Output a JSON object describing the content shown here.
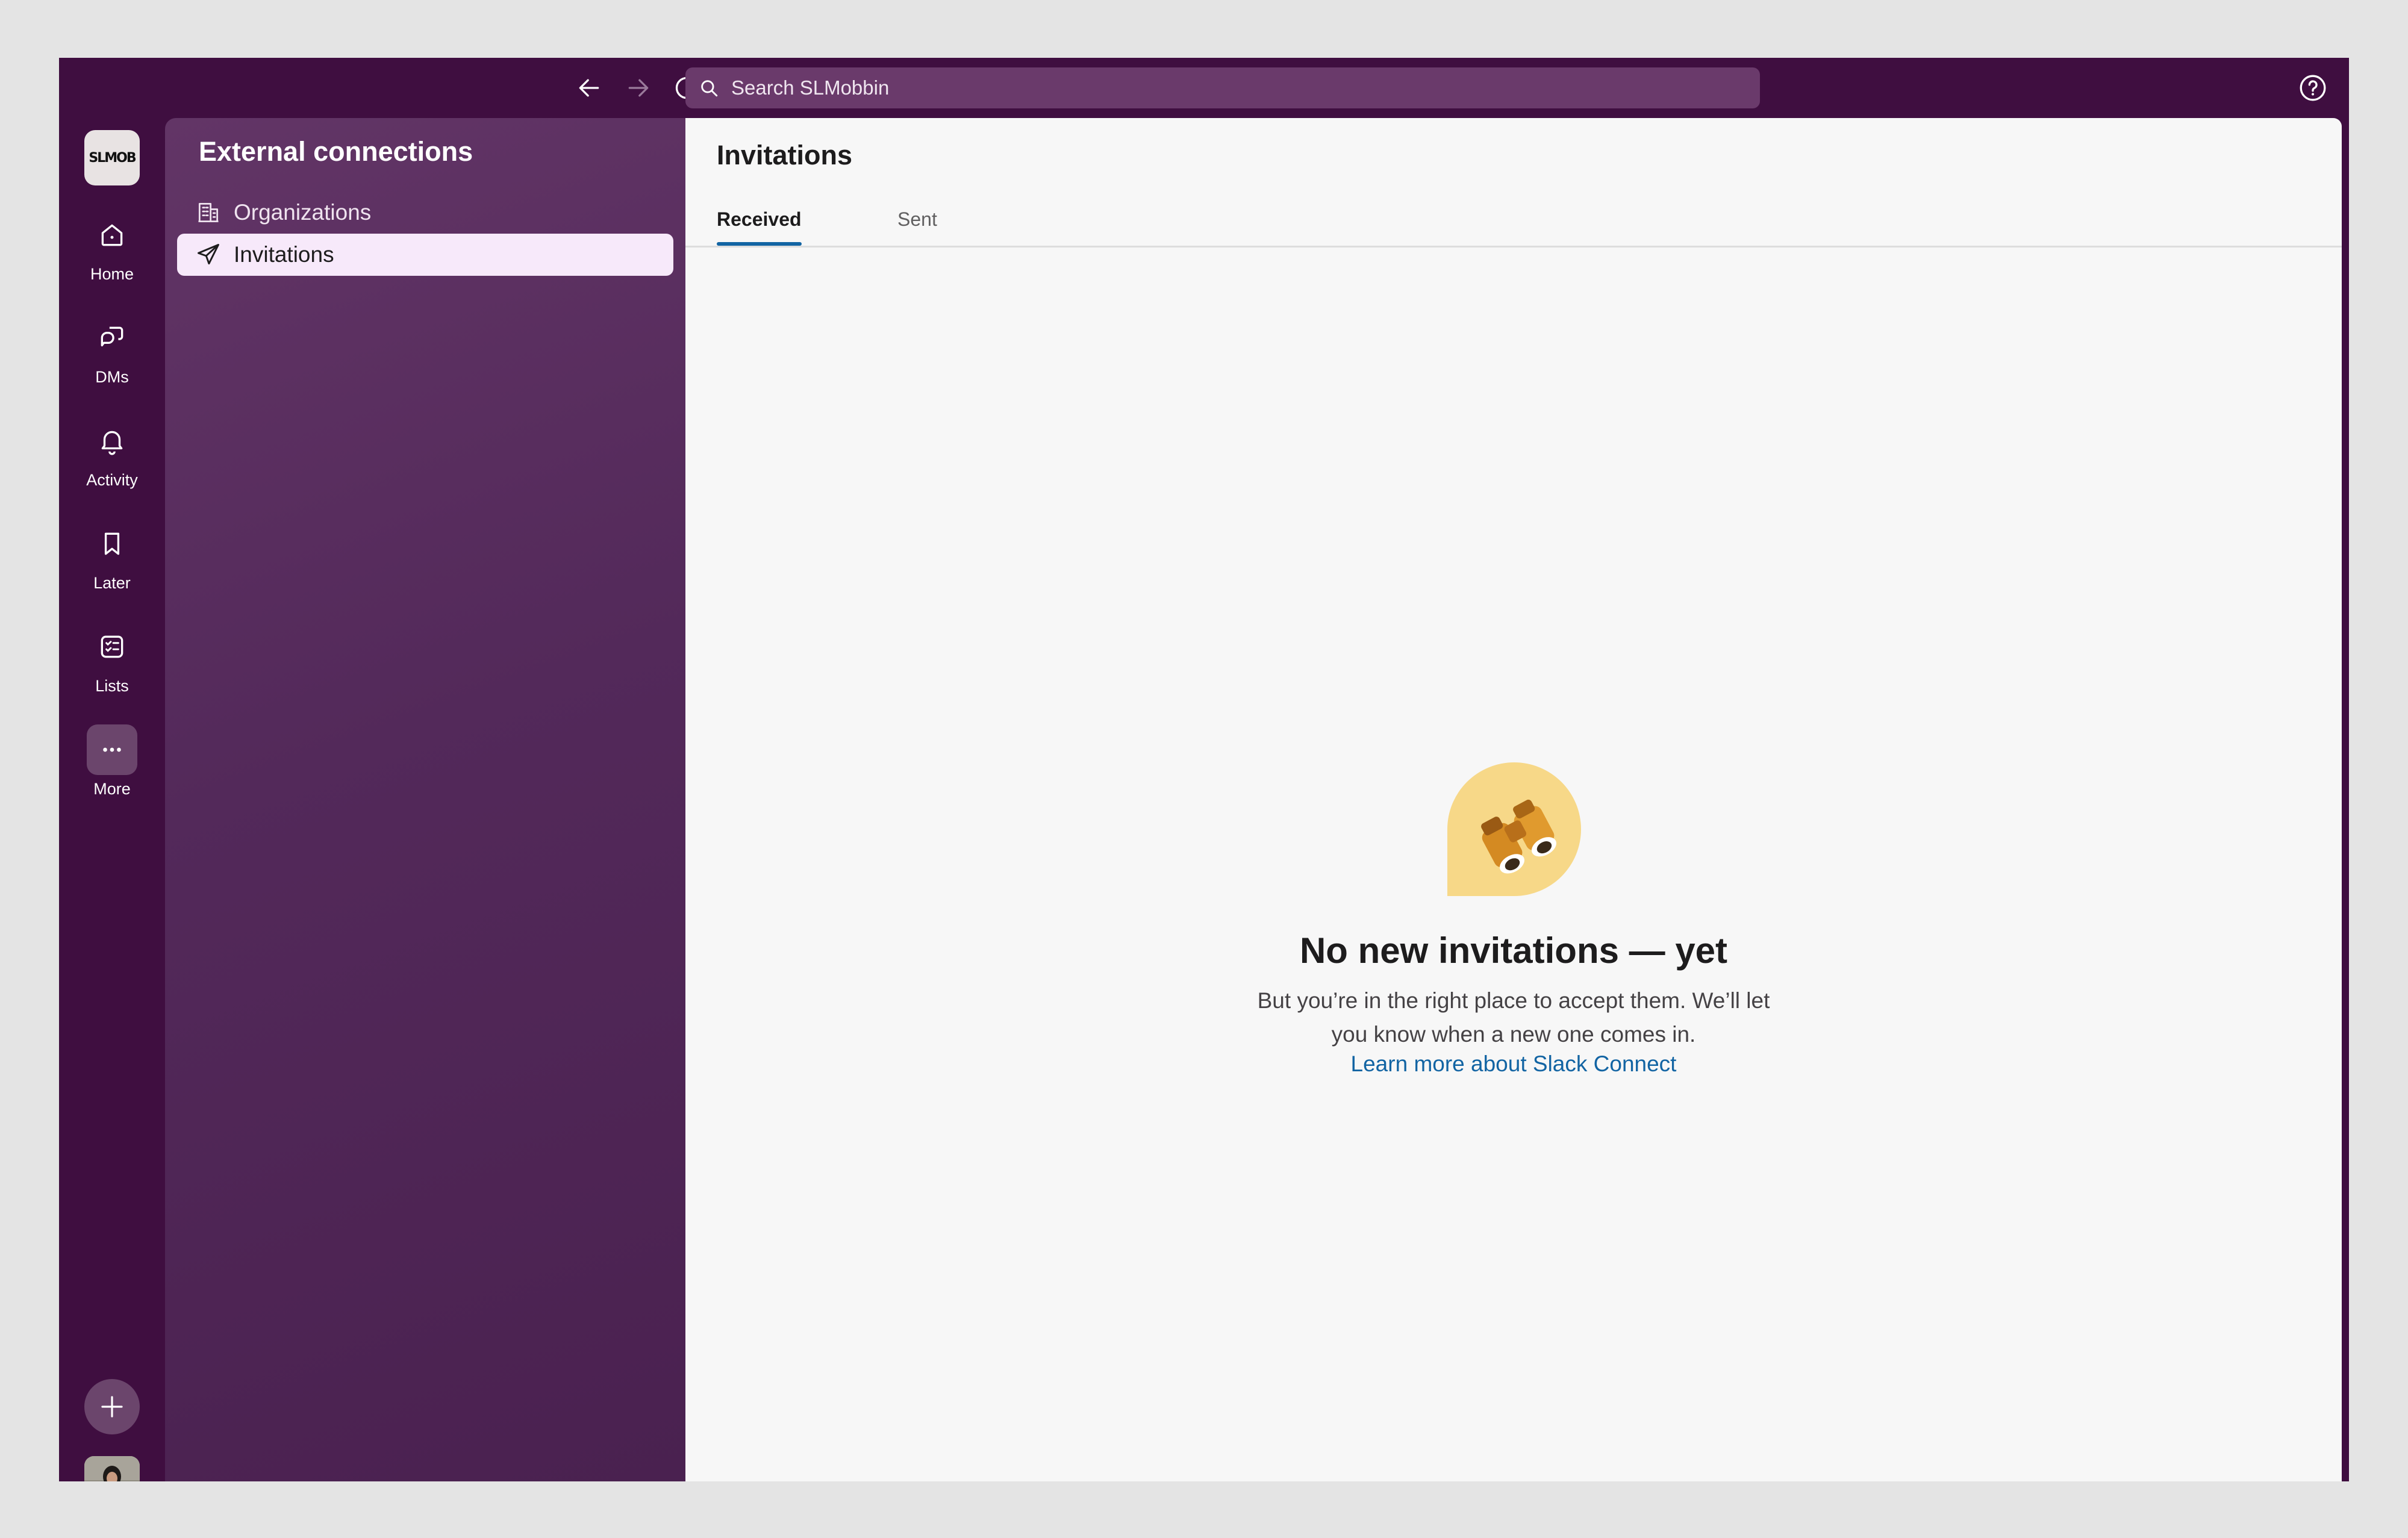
{
  "topbar": {
    "back_icon": "arrow-left-icon",
    "forward_icon": "arrow-right-icon",
    "history_icon": "clock-icon",
    "search_placeholder": "Search SLMobbin",
    "help_icon": "help-circle-icon"
  },
  "workspace": {
    "logo_text": "SLMOB"
  },
  "rail": {
    "items": [
      {
        "label": "Home",
        "icon": "home-icon"
      },
      {
        "label": "DMs",
        "icon": "dms-icon"
      },
      {
        "label": "Activity",
        "icon": "bell-icon"
      },
      {
        "label": "Later",
        "icon": "bookmark-icon"
      },
      {
        "label": "Lists",
        "icon": "lists-icon"
      },
      {
        "label": "More",
        "icon": "more-icon"
      }
    ],
    "add_icon": "plus-icon"
  },
  "sidebar": {
    "title": "External connections",
    "items": [
      {
        "label": "Organizations",
        "icon": "building-icon"
      },
      {
        "label": "Invitations",
        "icon": "paper-plane-icon",
        "selected": true
      }
    ]
  },
  "main": {
    "title": "Invitations",
    "tabs": [
      {
        "label": "Received",
        "active": true
      },
      {
        "label": "Sent",
        "active": false
      }
    ],
    "empty_state": {
      "illustration": "binoculars-icon",
      "title": "No new invitations — yet",
      "body": "But you’re in the right place to accept them. We’ll let you know when a new one comes in.",
      "link": "Learn more about Slack Connect"
    }
  },
  "colors": {
    "chrome": "#3f0e40",
    "sidebar": "#5a2c5e",
    "selected_item": "#f7e9fa",
    "link": "#1264a3",
    "illustration_bg": "#f7d888",
    "presence": "#2bac76"
  }
}
